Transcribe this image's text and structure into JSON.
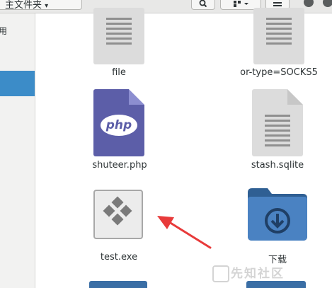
{
  "toolbar": {
    "path_label": "主文件夹",
    "search_icon": "search-icon",
    "view_icon": "view-options-icon",
    "menu_icon": "hamburger-menu-icon"
  },
  "sidebar": {
    "visible_label": "用"
  },
  "files": [
    {
      "name": "file",
      "icon": "text-document-icon"
    },
    {
      "name": "or-type=SOCKS5",
      "icon": "text-document-icon"
    },
    {
      "name": "shuteer.php",
      "icon": "php-file-icon",
      "badge": "php"
    },
    {
      "name": "stash.sqlite",
      "icon": "text-document-icon"
    },
    {
      "name": "test.exe",
      "icon": "executable-icon"
    },
    {
      "name": "下载",
      "icon": "download-folder-icon"
    }
  ],
  "watermark": {
    "text": "先知社区"
  },
  "colors": {
    "selection": "#3c8cc8",
    "arrow": "#e83a3a",
    "folder": "#3a6ea5",
    "php": "#5c5ea8"
  }
}
